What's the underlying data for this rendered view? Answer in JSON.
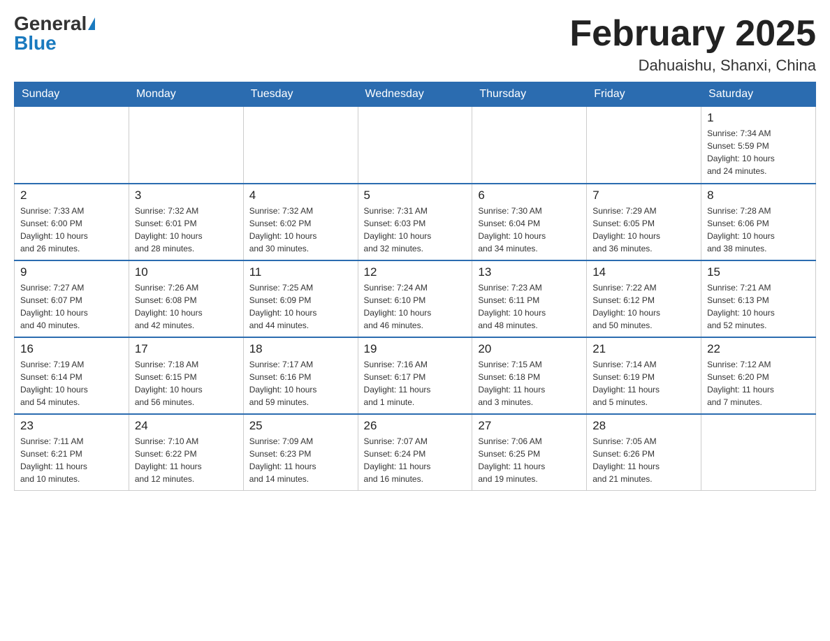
{
  "header": {
    "logo_general": "General",
    "logo_blue": "Blue",
    "month_title": "February 2025",
    "location": "Dahuaishu, Shanxi, China"
  },
  "weekdays": [
    "Sunday",
    "Monday",
    "Tuesday",
    "Wednesday",
    "Thursday",
    "Friday",
    "Saturday"
  ],
  "weeks": [
    [
      {
        "day": "",
        "info": ""
      },
      {
        "day": "",
        "info": ""
      },
      {
        "day": "",
        "info": ""
      },
      {
        "day": "",
        "info": ""
      },
      {
        "day": "",
        "info": ""
      },
      {
        "day": "",
        "info": ""
      },
      {
        "day": "1",
        "info": "Sunrise: 7:34 AM\nSunset: 5:59 PM\nDaylight: 10 hours\nand 24 minutes."
      }
    ],
    [
      {
        "day": "2",
        "info": "Sunrise: 7:33 AM\nSunset: 6:00 PM\nDaylight: 10 hours\nand 26 minutes."
      },
      {
        "day": "3",
        "info": "Sunrise: 7:32 AM\nSunset: 6:01 PM\nDaylight: 10 hours\nand 28 minutes."
      },
      {
        "day": "4",
        "info": "Sunrise: 7:32 AM\nSunset: 6:02 PM\nDaylight: 10 hours\nand 30 minutes."
      },
      {
        "day": "5",
        "info": "Sunrise: 7:31 AM\nSunset: 6:03 PM\nDaylight: 10 hours\nand 32 minutes."
      },
      {
        "day": "6",
        "info": "Sunrise: 7:30 AM\nSunset: 6:04 PM\nDaylight: 10 hours\nand 34 minutes."
      },
      {
        "day": "7",
        "info": "Sunrise: 7:29 AM\nSunset: 6:05 PM\nDaylight: 10 hours\nand 36 minutes."
      },
      {
        "day": "8",
        "info": "Sunrise: 7:28 AM\nSunset: 6:06 PM\nDaylight: 10 hours\nand 38 minutes."
      }
    ],
    [
      {
        "day": "9",
        "info": "Sunrise: 7:27 AM\nSunset: 6:07 PM\nDaylight: 10 hours\nand 40 minutes."
      },
      {
        "day": "10",
        "info": "Sunrise: 7:26 AM\nSunset: 6:08 PM\nDaylight: 10 hours\nand 42 minutes."
      },
      {
        "day": "11",
        "info": "Sunrise: 7:25 AM\nSunset: 6:09 PM\nDaylight: 10 hours\nand 44 minutes."
      },
      {
        "day": "12",
        "info": "Sunrise: 7:24 AM\nSunset: 6:10 PM\nDaylight: 10 hours\nand 46 minutes."
      },
      {
        "day": "13",
        "info": "Sunrise: 7:23 AM\nSunset: 6:11 PM\nDaylight: 10 hours\nand 48 minutes."
      },
      {
        "day": "14",
        "info": "Sunrise: 7:22 AM\nSunset: 6:12 PM\nDaylight: 10 hours\nand 50 minutes."
      },
      {
        "day": "15",
        "info": "Sunrise: 7:21 AM\nSunset: 6:13 PM\nDaylight: 10 hours\nand 52 minutes."
      }
    ],
    [
      {
        "day": "16",
        "info": "Sunrise: 7:19 AM\nSunset: 6:14 PM\nDaylight: 10 hours\nand 54 minutes."
      },
      {
        "day": "17",
        "info": "Sunrise: 7:18 AM\nSunset: 6:15 PM\nDaylight: 10 hours\nand 56 minutes."
      },
      {
        "day": "18",
        "info": "Sunrise: 7:17 AM\nSunset: 6:16 PM\nDaylight: 10 hours\nand 59 minutes."
      },
      {
        "day": "19",
        "info": "Sunrise: 7:16 AM\nSunset: 6:17 PM\nDaylight: 11 hours\nand 1 minute."
      },
      {
        "day": "20",
        "info": "Sunrise: 7:15 AM\nSunset: 6:18 PM\nDaylight: 11 hours\nand 3 minutes."
      },
      {
        "day": "21",
        "info": "Sunrise: 7:14 AM\nSunset: 6:19 PM\nDaylight: 11 hours\nand 5 minutes."
      },
      {
        "day": "22",
        "info": "Sunrise: 7:12 AM\nSunset: 6:20 PM\nDaylight: 11 hours\nand 7 minutes."
      }
    ],
    [
      {
        "day": "23",
        "info": "Sunrise: 7:11 AM\nSunset: 6:21 PM\nDaylight: 11 hours\nand 10 minutes."
      },
      {
        "day": "24",
        "info": "Sunrise: 7:10 AM\nSunset: 6:22 PM\nDaylight: 11 hours\nand 12 minutes."
      },
      {
        "day": "25",
        "info": "Sunrise: 7:09 AM\nSunset: 6:23 PM\nDaylight: 11 hours\nand 14 minutes."
      },
      {
        "day": "26",
        "info": "Sunrise: 7:07 AM\nSunset: 6:24 PM\nDaylight: 11 hours\nand 16 minutes."
      },
      {
        "day": "27",
        "info": "Sunrise: 7:06 AM\nSunset: 6:25 PM\nDaylight: 11 hours\nand 19 minutes."
      },
      {
        "day": "28",
        "info": "Sunrise: 7:05 AM\nSunset: 6:26 PM\nDaylight: 11 hours\nand 21 minutes."
      },
      {
        "day": "",
        "info": ""
      }
    ]
  ]
}
